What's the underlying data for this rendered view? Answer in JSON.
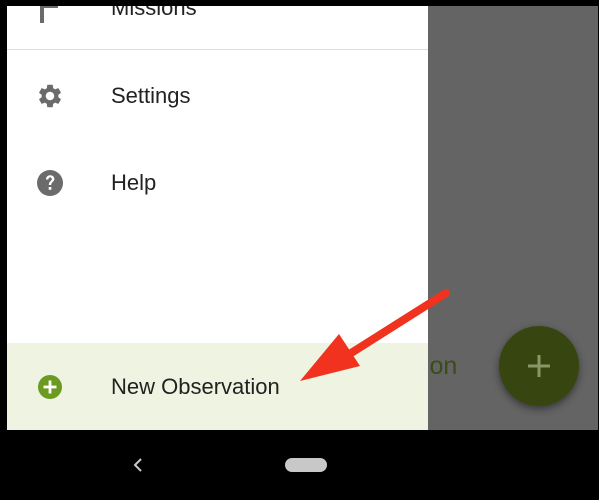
{
  "drawer": {
    "items": [
      {
        "label": "Missions",
        "icon": "flag-icon"
      },
      {
        "label": "Settings",
        "icon": "gear-icon"
      },
      {
        "label": "Help",
        "icon": "help-circle-icon"
      }
    ],
    "action": {
      "label": "New Observation",
      "icon": "add-circle-icon"
    }
  },
  "underlay": {
    "partial_label": "tion",
    "fab_icon": "plus-icon"
  },
  "annotation": {
    "arrow_color": "#f0321e"
  },
  "colors": {
    "accent_green": "#6a9a1f",
    "highlight_bg": "#eef4e1",
    "scrim": "#646464",
    "fab_dimmed": "#374610"
  },
  "navbar": {
    "back_icon": "back-chevron-icon",
    "home_icon": "home-pill-icon"
  }
}
